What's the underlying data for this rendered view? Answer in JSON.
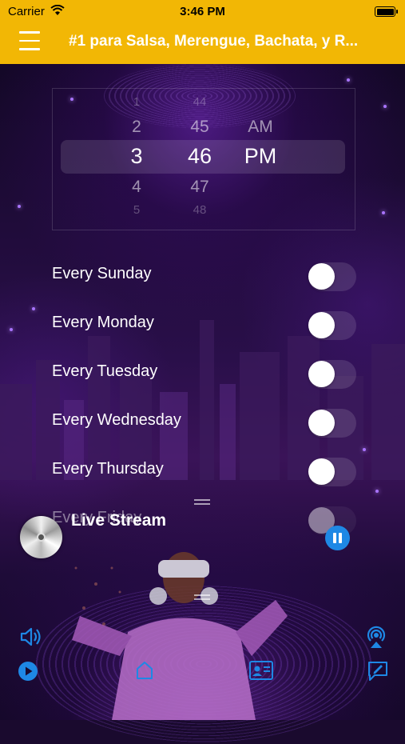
{
  "status_bar": {
    "carrier": "Carrier",
    "time": "3:46 PM"
  },
  "nav": {
    "title": "#1 para Salsa, Merengue, Bachata, y R..."
  },
  "time_picker": {
    "hours": [
      "1",
      "2",
      "3",
      "4",
      "5"
    ],
    "minutes": [
      "44",
      "45",
      "46",
      "47",
      "48"
    ],
    "periods": [
      "AM",
      "PM"
    ],
    "selected": {
      "hour": "3",
      "minute": "46",
      "period": "PM"
    }
  },
  "alarm_days": [
    {
      "label": "Every Sunday",
      "on": false
    },
    {
      "label": "Every Monday",
      "on": false
    },
    {
      "label": "Every Tuesday",
      "on": false
    },
    {
      "label": "Every Wednesday",
      "on": false
    },
    {
      "label": "Every Thursday",
      "on": false
    },
    {
      "label": "Every Friday",
      "on": false
    }
  ],
  "player": {
    "title": "Live Stream",
    "state": "playing"
  },
  "bottom_bar": {
    "icons": [
      "volume-icon",
      "airplay-icon",
      "play-icon",
      "home-icon",
      "contact-card-icon",
      "compose-icon"
    ]
  },
  "colors": {
    "topbar": "#f2b705",
    "accent_blue": "#1e88e5",
    "background": "#1a0a2e"
  }
}
